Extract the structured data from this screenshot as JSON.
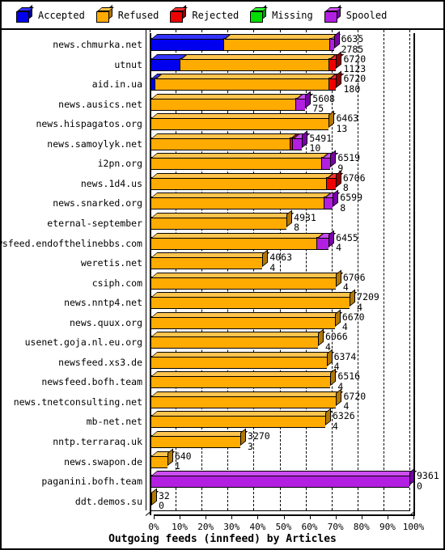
{
  "title": "Outgoing feeds (innfeed) by Articles",
  "legend": {
    "position": "top",
    "items": [
      {
        "label": "Accepted",
        "color": "#0000ee",
        "side": "#000099",
        "top": "#3333ff",
        "icon": "cube-icon"
      },
      {
        "label": "Refused",
        "color": "#ffab00",
        "side": "#b37800",
        "top": "#ffc44d",
        "icon": "cube-icon"
      },
      {
        "label": "Rejected",
        "color": "#ee0000",
        "side": "#990000",
        "top": "#ff3333",
        "icon": "cube-icon"
      },
      {
        "label": "Missing",
        "color": "#00dd00",
        "side": "#009900",
        "top": "#33ff33",
        "icon": "cube-icon"
      },
      {
        "label": "Spooled",
        "color": "#b31fe0",
        "side": "#7a00a8",
        "top": "#cc4df0",
        "icon": "cube-icon"
      }
    ]
  },
  "axis": {
    "x_ticks": [
      "0%",
      "10%",
      "20%",
      "30%",
      "40%",
      "50%",
      "60%",
      "70%",
      "80%",
      "90%",
      "100%"
    ],
    "x_min": 0,
    "x_max": 100,
    "grid": true
  },
  "chart_data": {
    "type": "bar",
    "orientation": "horizontal",
    "stacked": true,
    "title": "Outgoing feeds (innfeed) by Articles",
    "xlabel": "",
    "ylabel": "",
    "xlim": [
      0,
      100
    ],
    "xtick_labels": [
      "0%",
      "10%",
      "20%",
      "30%",
      "40%",
      "50%",
      "60%",
      "70%",
      "80%",
      "90%",
      "100%"
    ],
    "legend_position": "top",
    "series": [
      {
        "name": "Accepted",
        "color": "#0000ee"
      },
      {
        "name": "Refused",
        "color": "#ffab00"
      },
      {
        "name": "Rejected",
        "color": "#ee0000"
      },
      {
        "name": "Missing",
        "color": "#00dd00"
      },
      {
        "name": "Spooled",
        "color": "#b31fe0"
      }
    ],
    "categories": [
      "news.chmurka.net",
      "utnut",
      "aid.in.ua",
      "news.ausics.net",
      "news.hispagatos.org",
      "news.samoylyk.net",
      "i2pn.org",
      "news.1d4.us",
      "news.snarked.org",
      "eternal-september",
      "newsfeed.endofthelinebbs.com",
      "weretis.net",
      "csiph.com",
      "news.nntp4.net",
      "news.quux.org",
      "usenet.goja.nl.eu.org",
      "newsfeed.xs3.de",
      "newsfeed.bofh.team",
      "news.tnetconsulting.net",
      "mb-net.net",
      "nntp.terraraq.uk",
      "news.swapon.de",
      "paganini.bofh.team",
      "ddt.demos.su"
    ],
    "rows": [
      {
        "name": "news.chmurka.net",
        "total": 6635,
        "secondary": 2785,
        "pct": 70.9,
        "segments": [
          {
            "series": "Accepted",
            "pct": 28.2
          },
          {
            "series": "Refused",
            "pct": 41.0
          },
          {
            "series": "Spooled",
            "pct": 1.7
          }
        ]
      },
      {
        "name": "utnut",
        "total": 6720,
        "secondary": 1123,
        "pct": 71.8,
        "segments": [
          {
            "series": "Accepted",
            "pct": 11.5
          },
          {
            "series": "Refused",
            "pct": 57.3
          },
          {
            "series": "Rejected",
            "pct": 3.0
          }
        ]
      },
      {
        "name": "aid.in.ua",
        "total": 6720,
        "secondary": 180,
        "pct": 71.8,
        "segments": [
          {
            "series": "Accepted",
            "pct": 1.9
          },
          {
            "series": "Refused",
            "pct": 66.9
          },
          {
            "series": "Rejected",
            "pct": 3.0
          }
        ]
      },
      {
        "name": "news.ausics.net",
        "total": 5608,
        "secondary": 75,
        "pct": 59.9,
        "segments": [
          {
            "series": "Refused",
            "pct": 56.0
          },
          {
            "series": "Spooled",
            "pct": 3.9
          }
        ]
      },
      {
        "name": "news.hispagatos.org",
        "total": 6463,
        "secondary": 13,
        "pct": 69.0,
        "segments": [
          {
            "series": "Refused",
            "pct": 69.0
          }
        ]
      },
      {
        "name": "news.samoylyk.net",
        "total": 5491,
        "secondary": 10,
        "pct": 58.7,
        "segments": [
          {
            "series": "Refused",
            "pct": 54.0
          },
          {
            "series": "Rejected",
            "pct": 0.8
          },
          {
            "series": "Spooled",
            "pct": 3.9
          }
        ]
      },
      {
        "name": "i2pn.org",
        "total": 6519,
        "secondary": 9,
        "pct": 69.6,
        "segments": [
          {
            "series": "Refused",
            "pct": 66.0
          },
          {
            "series": "Spooled",
            "pct": 3.6
          }
        ]
      },
      {
        "name": "news.1d4.us",
        "total": 6706,
        "secondary": 8,
        "pct": 71.6,
        "segments": [
          {
            "series": "Refused",
            "pct": 68.0
          },
          {
            "series": "Rejected",
            "pct": 3.6
          }
        ]
      },
      {
        "name": "news.snarked.org",
        "total": 6599,
        "secondary": 8,
        "pct": 70.5,
        "segments": [
          {
            "series": "Refused",
            "pct": 67.0
          },
          {
            "series": "Spooled",
            "pct": 3.5
          }
        ]
      },
      {
        "name": "eternal-september",
        "total": 4931,
        "secondary": 8,
        "pct": 52.7,
        "segments": [
          {
            "series": "Refused",
            "pct": 52.7
          }
        ]
      },
      {
        "name": "newsfeed.endofthelinebbs.com",
        "total": 6455,
        "secondary": 4,
        "pct": 68.9,
        "segments": [
          {
            "series": "Refused",
            "pct": 64.3
          },
          {
            "series": "Spooled",
            "pct": 4.6
          }
        ]
      },
      {
        "name": "weretis.net",
        "total": 4063,
        "secondary": 4,
        "pct": 43.4,
        "segments": [
          {
            "series": "Refused",
            "pct": 43.4
          }
        ]
      },
      {
        "name": "csiph.com",
        "total": 6706,
        "secondary": 4,
        "pct": 71.6,
        "segments": [
          {
            "series": "Refused",
            "pct": 71.6
          }
        ]
      },
      {
        "name": "news.nntp4.net",
        "total": 7209,
        "secondary": 4,
        "pct": 77.0,
        "segments": [
          {
            "series": "Refused",
            "pct": 77.0
          }
        ]
      },
      {
        "name": "news.quux.org",
        "total": 6670,
        "secondary": 4,
        "pct": 71.3,
        "segments": [
          {
            "series": "Refused",
            "pct": 71.3
          }
        ]
      },
      {
        "name": "usenet.goja.nl.eu.org",
        "total": 6066,
        "secondary": 4,
        "pct": 64.8,
        "segments": [
          {
            "series": "Refused",
            "pct": 64.8
          }
        ]
      },
      {
        "name": "newsfeed.xs3.de",
        "total": 6374,
        "secondary": 4,
        "pct": 68.1,
        "segments": [
          {
            "series": "Refused",
            "pct": 68.1
          }
        ]
      },
      {
        "name": "newsfeed.bofh.team",
        "total": 6516,
        "secondary": 4,
        "pct": 69.6,
        "segments": [
          {
            "series": "Refused",
            "pct": 69.6
          }
        ]
      },
      {
        "name": "news.tnetconsulting.net",
        "total": 6720,
        "secondary": 4,
        "pct": 71.8,
        "segments": [
          {
            "series": "Refused",
            "pct": 71.8
          }
        ]
      },
      {
        "name": "mb-net.net",
        "total": 6326,
        "secondary": 4,
        "pct": 67.6,
        "segments": [
          {
            "series": "Refused",
            "pct": 67.6
          }
        ]
      },
      {
        "name": "nntp.terraraq.uk",
        "total": 3270,
        "secondary": 3,
        "pct": 34.9,
        "segments": [
          {
            "series": "Refused",
            "pct": 34.9
          }
        ]
      },
      {
        "name": "news.swapon.de",
        "total": 640,
        "secondary": 1,
        "pct": 6.8,
        "segments": [
          {
            "series": "Refused",
            "pct": 6.8
          }
        ]
      },
      {
        "name": "paganini.bofh.team",
        "total": 9361,
        "secondary": 0,
        "pct": 100.0,
        "segments": [
          {
            "series": "Spooled",
            "pct": 100.0
          }
        ]
      },
      {
        "name": "ddt.demos.su",
        "total": 32,
        "secondary": 0,
        "pct": 0.4,
        "segments": [
          {
            "series": "Refused",
            "pct": 0.4
          }
        ]
      }
    ]
  }
}
